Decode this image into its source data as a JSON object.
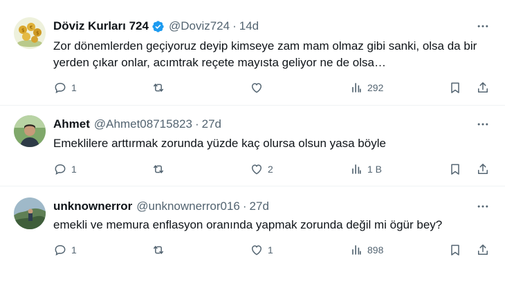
{
  "tweets": [
    {
      "name": "Döviz Kurları 724",
      "verified": true,
      "handle": "@Doviz724",
      "dot": "·",
      "time": "14d",
      "text": "Zor dönemlerden geçiyoruz deyip kimseye zam mam olmaz gibi sanki, olsa da bir yerden çıkar onlar, acımtrak reçete mayısta geliyor ne de olsa…",
      "replies": "1",
      "retweets": "",
      "likes": "",
      "views": "292"
    },
    {
      "name": "Ahmet",
      "handle": "@Ahmet08715823",
      "dot": "·",
      "time": "27d",
      "text": "Emeklilere arttırmak zorunda yüzde kaç olursa olsun yasa böyle",
      "replies": "1",
      "retweets": "",
      "likes": "2",
      "views": "1 B"
    },
    {
      "name": "unknownerror",
      "handle": "@unknownerror016",
      "dot": "·",
      "time": "27d",
      "text": "emekli ve memura enflasyon oranında yapmak zorunda değil mi ögür bey?",
      "replies": "1",
      "retweets": "",
      "likes": "1",
      "views": "898"
    }
  ],
  "icons": {
    "reply": "reply-icon",
    "retweet": "retweet-icon",
    "like": "like-icon",
    "views": "views-icon",
    "bookmark": "bookmark-icon",
    "share": "share-icon",
    "more": "more-icon",
    "verified": "verified-badge-icon"
  },
  "colors": {
    "text": "#0f1419",
    "secondary": "#536471",
    "verified": "#1d9bf0",
    "divider": "#eff3f4"
  }
}
